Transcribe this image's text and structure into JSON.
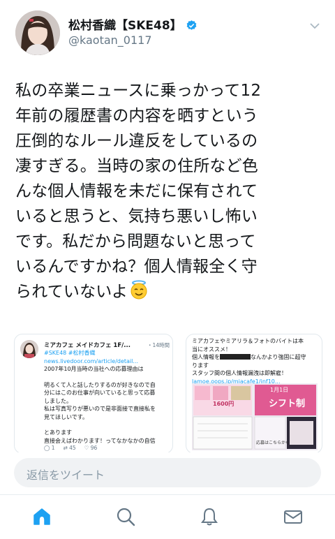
{
  "tweet": {
    "author_name": "松村香織【SKE48】",
    "handle": "@kaotan_0117",
    "text_lines": [
      "私の卒業ニュースに乗っかって12",
      "年前の履歴書の内容を晒すという",
      "圧倒的なルール違反をしているの",
      "凄すぎる。当時の家の住所など色",
      "んな個人情報を未だに保有されて",
      "いると思うと、気持ち悪いし怖い",
      "です。私だから問題ないと思って",
      "いるんですかね？個人情報全く守",
      "られていないよ"
    ],
    "emoji": "halo-face-emoji"
  },
  "card1": {
    "header": "ミアカフェ メイドカフェ 1F/...",
    "time": "・14時間",
    "lines": [
      "#SKE48 #松村香織",
      "news.livedoor.com/article/detail...",
      "2007年10月当時の当社への応募理由は",
      "",
      "明るくて人と話したりするのが好きなので自",
      "分にはこのお仕事が向いていると思って応募",
      "しました。",
      "私は写真写りが悪いので是非面接で直接私を",
      "見てほしいです。",
      "",
      "とあります",
      "直接会えばわかります！ってなかなかの自信"
    ],
    "reply_count": "1",
    "retweet_count": "45",
    "like_count": "96"
  },
  "card2": {
    "lines": [
      "ミアカフェやミアリラ＆フォトのバイトは本",
      "当にオススメ！",
      "個人情報を",
      "なんかより強固に超守",
      "ります",
      "スタッフ間の個人情報漏洩は即解雇！",
      "lamoe.oops.jp/miacafe1/inf10..."
    ],
    "image_texts": [
      "1600円",
      "シフト制",
      "1月1日",
      "応募はこちらから"
    ]
  },
  "reply_box": {
    "placeholder": "返信をツイート"
  },
  "tabs": [
    "home-icon",
    "search-icon",
    "notifications-icon",
    "messages-icon"
  ],
  "colors": {
    "accent": "#1da1f2",
    "text": "#14171a",
    "secondary": "#657786"
  }
}
